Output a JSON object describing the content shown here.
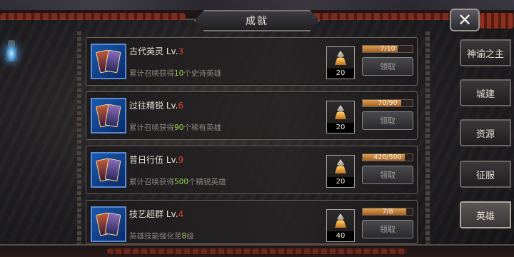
{
  "header": {
    "title": "成就",
    "close_label": "✕"
  },
  "achievements": [
    {
      "name": "古代英灵",
      "level_prefix": "Lv.",
      "level": "3",
      "desc_before": "累计召唤获得",
      "desc_value": "10",
      "desc_after": "个史诗英雄",
      "reward_count": "20",
      "progress_text": "7/10",
      "progress": 0.7,
      "claim_label": "领取"
    },
    {
      "name": "过往精锐",
      "level_prefix": "Lv.",
      "level": "6",
      "desc_before": "累计召唤获得",
      "desc_value": "90",
      "desc_after": "个稀有英雄",
      "reward_count": "20",
      "progress_text": "70/90",
      "progress": 0.778,
      "claim_label": "领取"
    },
    {
      "name": "昔日行伍",
      "level_prefix": "Lv.",
      "level": "9",
      "desc_before": "累计召唤获得",
      "desc_value": "500",
      "desc_after": "个精锐英雄",
      "reward_count": "20",
      "progress_text": "420/500",
      "progress": 0.84,
      "claim_label": "领取"
    },
    {
      "name": "技艺超群",
      "level_prefix": "Lv.",
      "level": "4",
      "desc_before": "英雄技能强化至",
      "desc_value": "8",
      "desc_after": "级",
      "reward_count": "40",
      "progress_text": "7/8",
      "progress": 0.875,
      "claim_label": "领取"
    }
  ],
  "tabs": [
    {
      "label": "神谕之主",
      "active": false
    },
    {
      "label": "城建",
      "active": false
    },
    {
      "label": "资源",
      "active": false
    },
    {
      "label": "征服",
      "active": false
    },
    {
      "label": "英雄",
      "active": true
    }
  ],
  "colors": {
    "level_number": "#e04030",
    "desc_highlight": "#9ad84a",
    "progress_fill": "#d08a3a"
  }
}
